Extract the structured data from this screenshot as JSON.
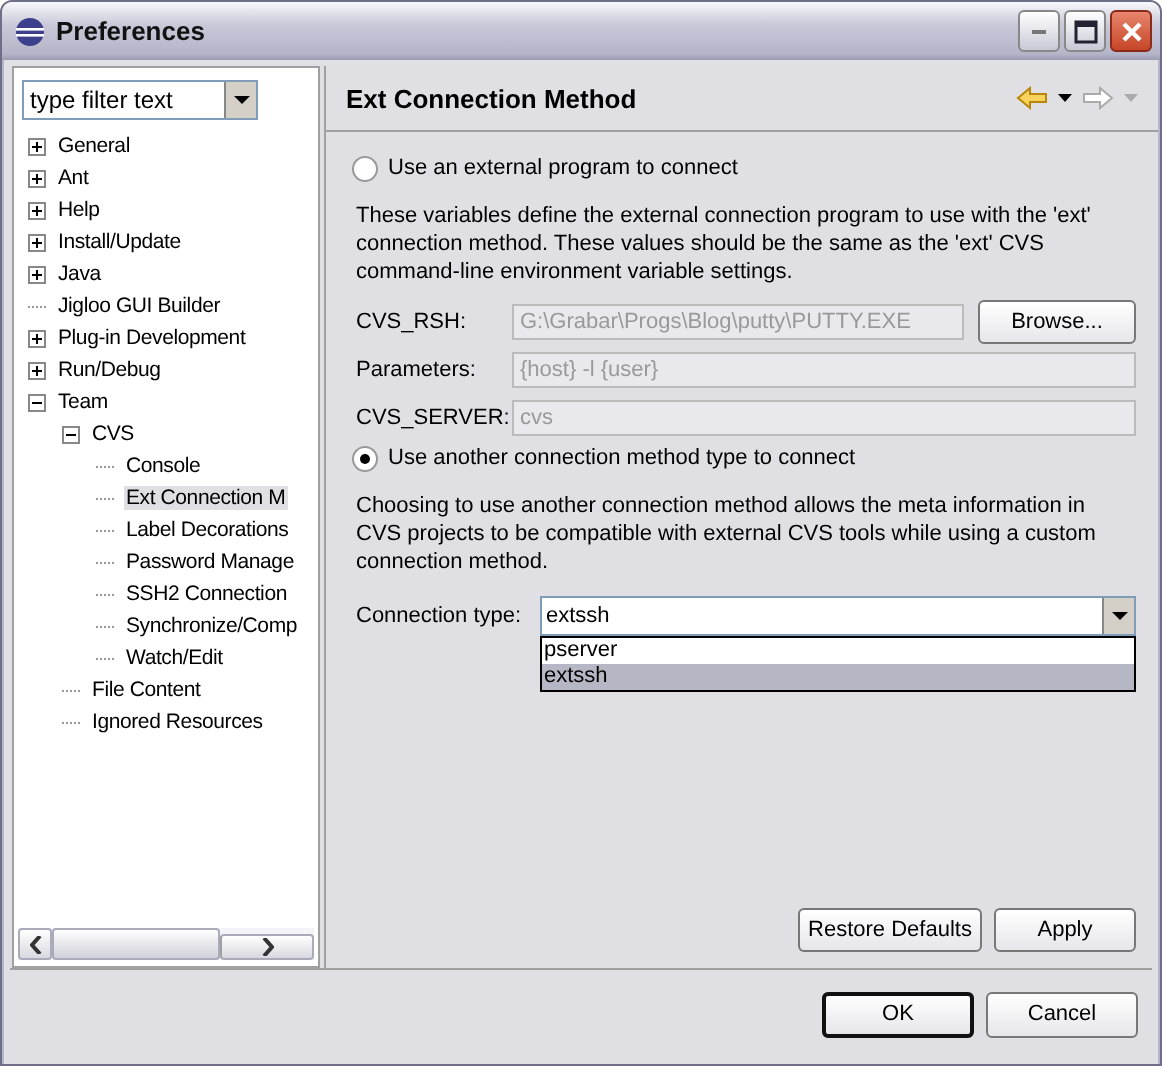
{
  "window": {
    "title": "Preferences"
  },
  "filter": {
    "placeholder": "type filter text"
  },
  "tree": [
    {
      "label": "General",
      "expanded": false,
      "selected": false
    },
    {
      "label": "Ant",
      "expanded": false,
      "selected": false
    },
    {
      "label": "Help",
      "expanded": false,
      "selected": false
    },
    {
      "label": "Install/Update",
      "expanded": false,
      "selected": false
    },
    {
      "label": "Java",
      "expanded": false,
      "selected": false
    },
    {
      "label": "Jigloo GUI Builder",
      "selected": false
    },
    {
      "label": "Plug-in Development",
      "expanded": false,
      "selected": false
    },
    {
      "label": "Run/Debug",
      "expanded": false,
      "selected": false
    },
    {
      "label": "Team",
      "expanded": true,
      "selected": false,
      "children": [
        {
          "label": "CVS",
          "expanded": true,
          "selected": false,
          "children": [
            {
              "label": "Console",
              "selected": false
            },
            {
              "label": "Ext Connection M",
              "selected": true
            },
            {
              "label": "Label Decorations",
              "selected": false
            },
            {
              "label": "Password Manage",
              "selected": false
            },
            {
              "label": "SSH2 Connection",
              "selected": false
            },
            {
              "label": "Synchronize/Comp",
              "selected": false
            },
            {
              "label": "Watch/Edit",
              "selected": false
            }
          ]
        },
        {
          "label": "File Content",
          "selected": false
        },
        {
          "label": "Ignored Resources",
          "selected": false
        }
      ]
    }
  ],
  "page": {
    "title": "Ext Connection Method",
    "options": [
      {
        "label": "Use an external program to connect",
        "selected": false,
        "description": "These variables define the external connection program to use with the 'ext' connection method. These values should be the same as the 'ext' CVS command-line environment variable settings.",
        "fields": [
          {
            "label": "CVS_RSH:",
            "value": "G:\\Grabar\\Progs\\Blog\\putty\\PUTTY.EXE",
            "disabled": true,
            "button": "Browse..."
          },
          {
            "label": "Parameters:",
            "value": "{host} -l {user}",
            "disabled": true
          },
          {
            "label": "CVS_SERVER:",
            "value": "cvs",
            "disabled": true
          }
        ]
      },
      {
        "label": "Use another connection method type to connect",
        "selected": true,
        "description": "Choosing to use another connection method allows the meta information in CVS projects to be compatible with external CVS tools while using a custom connection method.",
        "connection_type": {
          "label": "Connection type:",
          "value": "extssh",
          "expanded": true,
          "options": [
            {
              "label": "pserver",
              "selected": false
            },
            {
              "label": "extssh",
              "selected": true
            }
          ]
        }
      }
    ],
    "buttons": [
      "Restore Defaults",
      "Apply"
    ]
  },
  "buttons": [
    "OK",
    "Cancel"
  ]
}
